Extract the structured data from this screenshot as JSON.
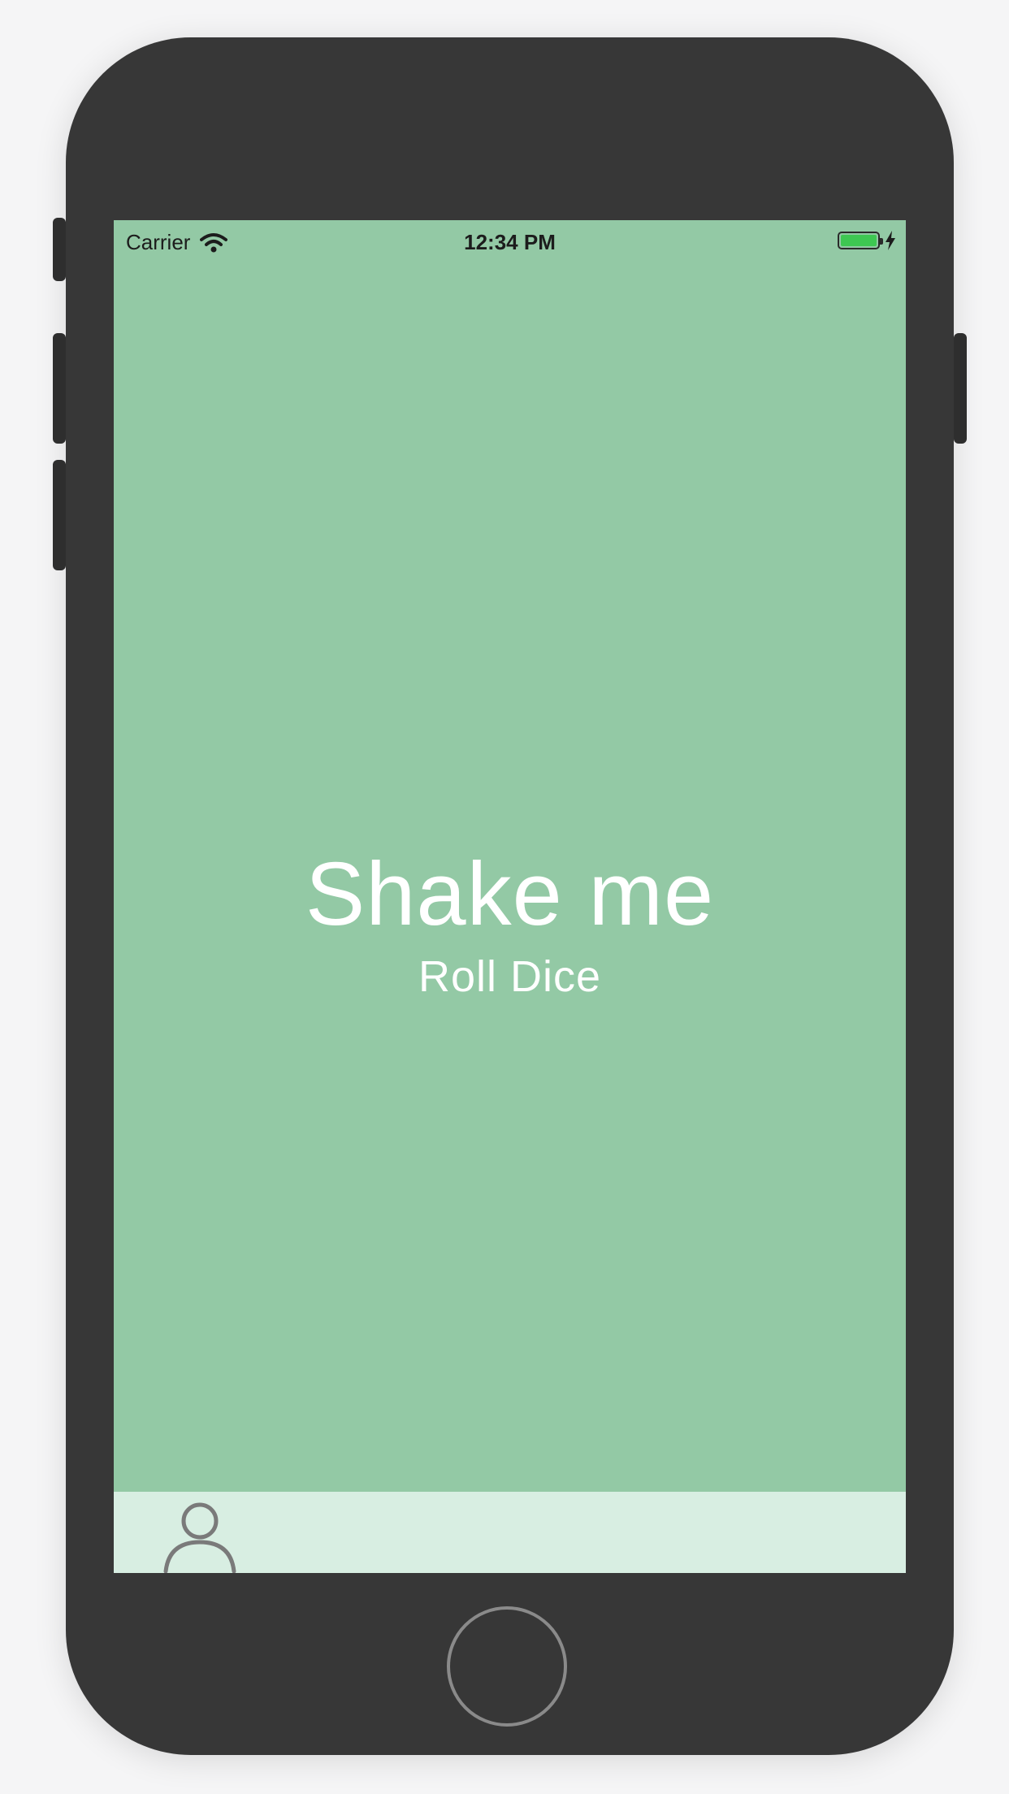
{
  "status_bar": {
    "carrier": "Carrier",
    "time": "12:34 PM",
    "wifi_icon": "wifi-icon",
    "battery_icon": "battery-icon",
    "battery_level": 1.0,
    "charging_icon": "bolt-icon"
  },
  "main": {
    "title": "Shake me",
    "subtitle": "Roll Dice"
  },
  "tab_bar": {
    "items": [
      {
        "icon": "user-icon"
      }
    ]
  },
  "colors": {
    "screen_background": "#93c9a5",
    "tab_bar_background": "#d8eee2",
    "text": "#ffffff",
    "device_body": "#373737",
    "battery_fill": "#3ec752"
  }
}
